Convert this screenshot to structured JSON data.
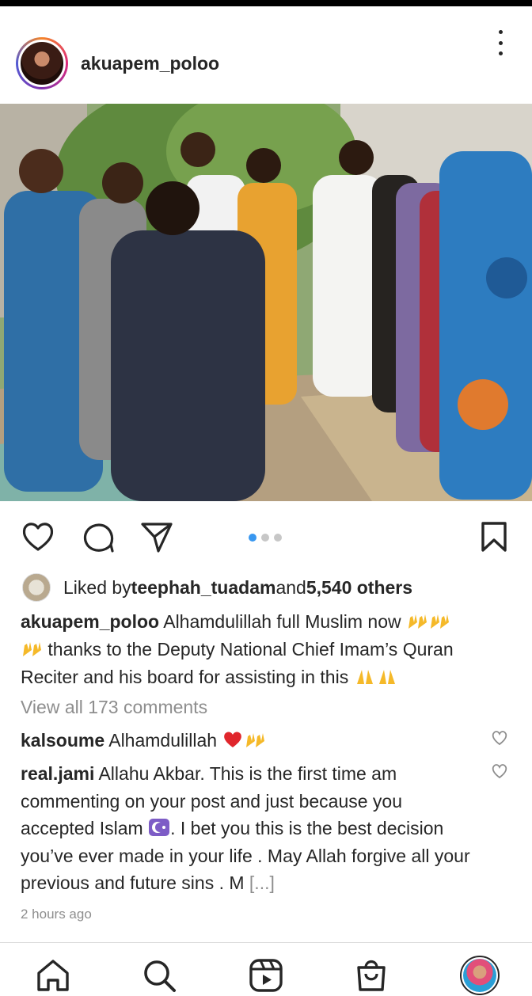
{
  "post": {
    "username": "akuapem_poloo",
    "liked_by_prefix": "Liked by ",
    "liked_by_user": "teephah_tuadam",
    "liked_by_and": " and ",
    "liked_by_count": "5,540 others",
    "caption_user": "akuapem_poloo",
    "caption_part1": " Alhamdulillah full Muslim now ",
    "caption_part2": " thanks to the Deputy National Chief Imam’s Quran Reciter and his board for assisting  in this ",
    "view_all_comments": "View all 173 comments",
    "timestamp": "2 hours ago",
    "carousel_position": 1,
    "carousel_total": 3
  },
  "comments": [
    {
      "user": "kalsoume",
      "text": " Alhamdulillah "
    },
    {
      "user": "real.jami",
      "text_part1": " Allahu Akbar. This is the first time am commenting on your post and just because you accepted Islam ",
      "text_part2": ". I bet you this is the best decision you’ve ever made in your life . May Allah forgive all your previous and future sins . M ",
      "more": "[...]"
    }
  ],
  "colors": {
    "accent_blue": "#3897f0",
    "text": "#262626",
    "muted": "#8e8e8e",
    "heart_red": "#e0262c"
  },
  "icons": [
    "heart-icon",
    "comment-icon",
    "share-icon",
    "bookmark-icon",
    "home-icon",
    "search-icon",
    "reels-icon",
    "shop-icon"
  ]
}
